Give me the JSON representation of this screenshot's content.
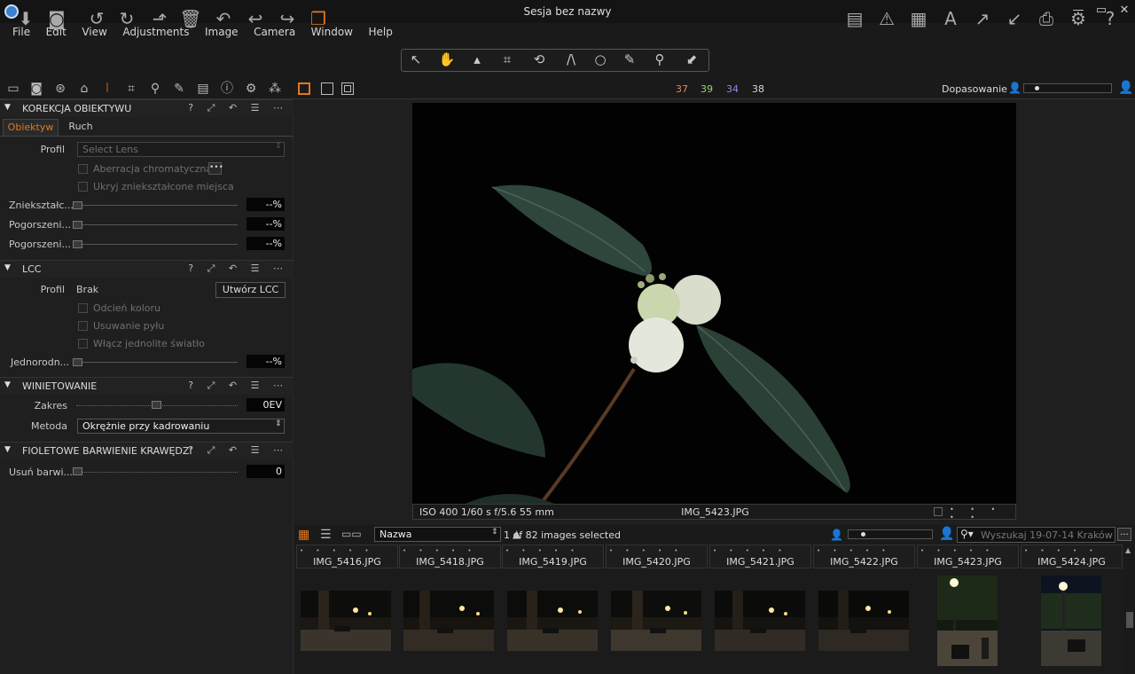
{
  "window": {
    "title": "Sesja bez nazwy",
    "min": "—",
    "restore": "▭",
    "close": "✕"
  },
  "menu": [
    "File",
    "Edit",
    "View",
    "Adjustments",
    "Image",
    "Camera",
    "Window",
    "Help"
  ],
  "tooltabs": {
    "active_index": 5
  },
  "viewer_bar": {
    "counts": [
      "37",
      "39",
      "34",
      "38"
    ],
    "count_colors": [
      "#e8865a",
      "#8fd96a",
      "#8c8cf0",
      "#d6d6d6"
    ],
    "fit_label": "Dopasowanie"
  },
  "lens": {
    "header": "KOREKCJA OBIEKTYWU",
    "tabs": [
      "Obiektyw",
      "Ruch"
    ],
    "profile_label": "Profil",
    "profile_placeholder": "Select Lens",
    "cb_chromatic": "Aberracja chromatyczna",
    "cb_hide": "Ukryj zniekształcone miejsca",
    "sliders": [
      {
        "label": "Zniekształc...",
        "value": "--%"
      },
      {
        "label": "Pogorszeni...",
        "value": "--%"
      },
      {
        "label": "Pogorszeni...",
        "value": "--%"
      }
    ]
  },
  "lcc": {
    "header": "LCC",
    "profile_label": "Profil",
    "profile_value": "Brak",
    "create_button": "Utwórz LCC",
    "cb_color": "Odcień koloru",
    "cb_dust": "Usuwanie pyłu",
    "cb_light": "Włącz jednolite światło",
    "uniform_label": "Jednorodn...",
    "uniform_value": "--%"
  },
  "vignette": {
    "header": "WINIETOWANIE",
    "amount_label": "Zakres",
    "amount_value": "0EV",
    "method_label": "Metoda",
    "method_value": "Okrężnie przy kadrowaniu",
    "amount_fraction": 0.5
  },
  "fringe": {
    "header": "FIOLETOWE BARWIENIE KRAWĘDZI",
    "label": "Usuń barwi...",
    "value": "0"
  },
  "info": {
    "exif": "ISO 400  1/60 s  f/5.6  55 mm",
    "filename": "IMG_5423.JPG"
  },
  "browser": {
    "sort_value": "Nazwa",
    "selection": "1 of 82 images selected",
    "search_placeholder": "Wyszukaj 19-07-14 Kraków (",
    "more": "..."
  },
  "thumbs": [
    "IMG_5416.JPG",
    "IMG_5418.JPG",
    "IMG_5419.JPG",
    "IMG_5420.JPG",
    "IMG_5421.JPG",
    "IMG_5422.JPG",
    "IMG_5423.JPG",
    "IMG_5424.JPG"
  ],
  "thumb_dots": "• • • • •"
}
